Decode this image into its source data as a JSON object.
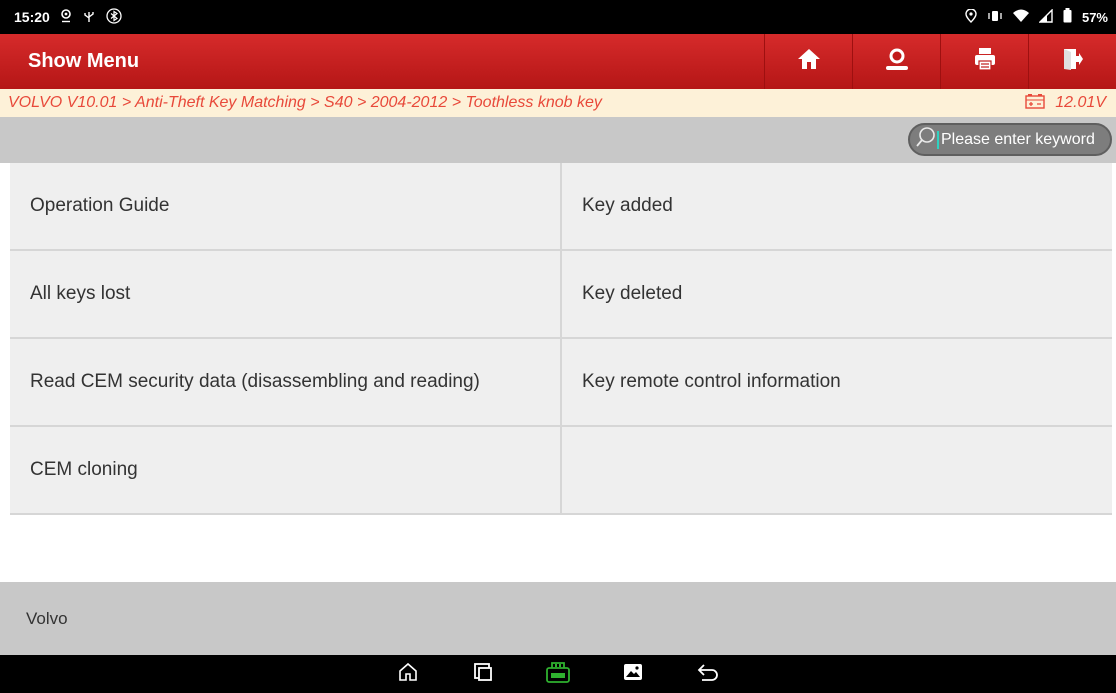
{
  "status_bar": {
    "time": "15:20",
    "battery": "57%",
    "left_icons": [
      "location-icon",
      "usb-icon",
      "bluetooth-icon"
    ],
    "right_icons": [
      "location-icon",
      "vibrate-icon",
      "wifi-icon",
      "signal-icon",
      "battery-icon"
    ]
  },
  "header": {
    "title": "Show Menu",
    "buttons": [
      "home-icon",
      "user-icon",
      "print-icon",
      "exit-icon"
    ],
    "accent": "#c8201e"
  },
  "breadcrumb": {
    "path": "VOLVO V10.01 > Anti-Theft Key Matching > S40 > 2004-2012 > Toothless knob key",
    "voltage": "12.01V",
    "color": "#e8493a"
  },
  "search": {
    "placeholder": "Please enter keyword"
  },
  "menu": {
    "rows": [
      {
        "left": "Operation Guide",
        "right": "Key added"
      },
      {
        "left": "All keys lost",
        "right": "Key deleted"
      },
      {
        "left": "Read CEM security data (disassembling and reading)",
        "right": "Key remote control information"
      },
      {
        "left": "CEM cloning",
        "right": ""
      }
    ]
  },
  "footer": {
    "label": "Volvo"
  },
  "navbar": {
    "buttons": [
      "home-icon",
      "recent-apps-icon",
      "vci-icon",
      "screenshot-icon",
      "back-icon"
    ],
    "vci_color": "#2fb12f"
  }
}
